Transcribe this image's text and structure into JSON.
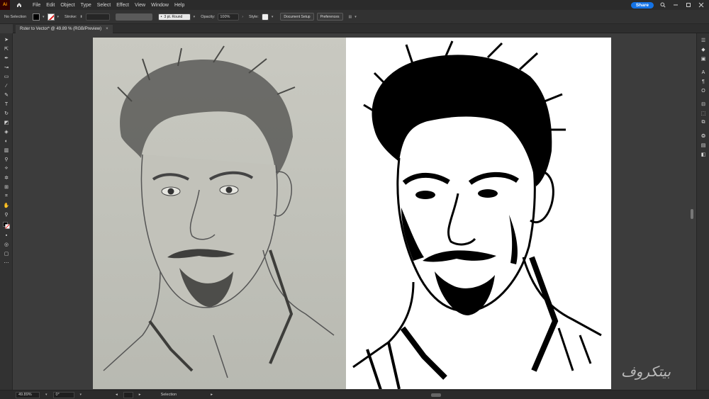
{
  "app": {
    "logo": "Ai",
    "menus": [
      "File",
      "Edit",
      "Object",
      "Type",
      "Select",
      "Effect",
      "View",
      "Window",
      "Help"
    ],
    "share_label": "Share"
  },
  "control_bar": {
    "selection_status": "No Selection",
    "stroke_label": "Stroke:",
    "brush_label": "3 pt. Round",
    "opacity_label": "Opacity:",
    "opacity_value": "100%",
    "style_label": "Style:",
    "document_setup_label": "Document Setup",
    "preferences_label": "Preferences"
  },
  "document": {
    "tab_title": "Rster to Vector* @ 49.89 % (RGB/Preview)",
    "close_symbol": "×"
  },
  "status_bar": {
    "zoom": "49.89%",
    "rotation": "0°",
    "tool_name": "Selection"
  },
  "watermark": {
    "text": "بیتکروف"
  },
  "colors": {
    "accent": "#1473e6",
    "fill": "#000000",
    "stroke_none": "#e21d1d"
  }
}
